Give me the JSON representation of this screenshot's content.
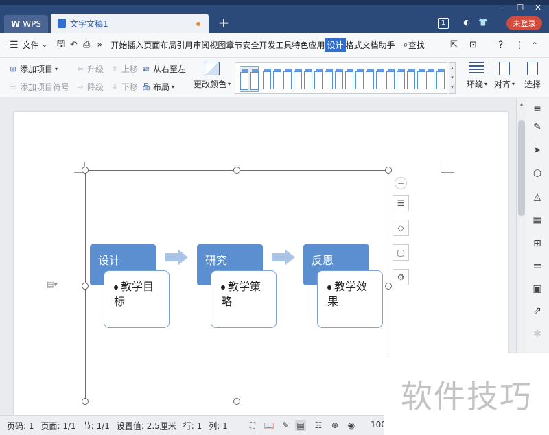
{
  "titlebar": {
    "app_tab": "WPS",
    "doc_tab": "文字文稿1",
    "new_tab": "+",
    "badge": "1",
    "login_label": "未登录"
  },
  "menubar": {
    "file_label": "文件",
    "items": [
      "开始",
      "插入",
      "页面布局",
      "引用",
      "审阅",
      "视图",
      "章节",
      "安全",
      "开发工具",
      "特色应用",
      "设计",
      "格式",
      "文档助手"
    ],
    "active": "设计",
    "search_label": "查找"
  },
  "ribbon": {
    "add_item": "添加项目",
    "add_bullet": "添加项目符号",
    "promote": "升级",
    "demote": "降级",
    "move_up": "上移",
    "move_down": "下移",
    "right_to_left": "从右至左",
    "layout": "布局",
    "change_color": "更改颜色",
    "wrap": "环绕",
    "align": "对齐",
    "select": "选择"
  },
  "smartart": {
    "nodes": [
      {
        "header": "设计",
        "bullet_line1": "教学目",
        "bullet_line2": "标"
      },
      {
        "header": "研究",
        "bullet_line1": "教学策",
        "bullet_line2": "略"
      },
      {
        "header": "反思",
        "bullet_line1": "教学效",
        "bullet_line2": "果"
      }
    ],
    "header_color": "#5b8fd0",
    "arrow_color": "#a9c4e8"
  },
  "statusbar": {
    "page_num": "页码: 1",
    "pages": "页面: 1/1",
    "section": "节: 1/1",
    "setting": "设置值: 2.5厘米",
    "row": "行: 1",
    "col": "列: 1",
    "zoom": "100"
  },
  "watermark": "软件技巧",
  "colors": {
    "titlebar": "#2b4a7a",
    "accent": "#2f6fd1",
    "login": "#d24b3c"
  }
}
